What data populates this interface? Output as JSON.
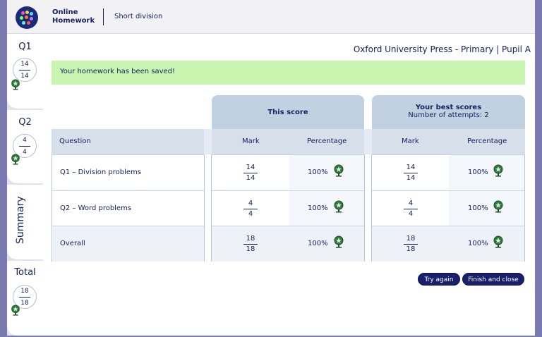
{
  "header": {
    "app_name": "Online Homework",
    "subject": "Short division"
  },
  "sidebar": {
    "q1": {
      "label": "Q1",
      "score": "14",
      "total": "14"
    },
    "q2": {
      "label": "Q2",
      "score": "4",
      "total": "4"
    },
    "summary": {
      "label": "Summary"
    },
    "total": {
      "label": "Total",
      "score": "18",
      "total": "18"
    }
  },
  "publisher": "Oxford University Press - Primary | Pupil A",
  "saved_message": "Your homework has been saved!",
  "table": {
    "this_score_title": "This score",
    "best_scores_title": "Your best scores",
    "attempts_text": "Number of attempts: 2",
    "col_question": "Question",
    "col_mark": "Mark",
    "col_percentage": "Percentage",
    "rows": [
      {
        "label": "Q1 – Division problems",
        "mark_num": "14",
        "mark_den": "14",
        "pct": "100%",
        "best_num": "14",
        "best_den": "14",
        "best_pct": "100%"
      },
      {
        "label": "Q2 – Word problems",
        "mark_num": "4",
        "mark_den": "4",
        "pct": "100%",
        "best_num": "4",
        "best_den": "4",
        "best_pct": "100%"
      },
      {
        "label": "Overall",
        "mark_num": "18",
        "mark_den": "18",
        "pct": "100%",
        "best_num": "18",
        "best_den": "18",
        "best_pct": "100%"
      }
    ]
  },
  "buttons": {
    "try_again": "Try again",
    "finish": "Finish and close"
  },
  "icons": {
    "trophy": "trophy-icon",
    "logo": "app-logo"
  },
  "colors": {
    "accent": "#1a1f6b",
    "banner": "#c8f5b0",
    "header_blue": "#c2d1e2"
  }
}
